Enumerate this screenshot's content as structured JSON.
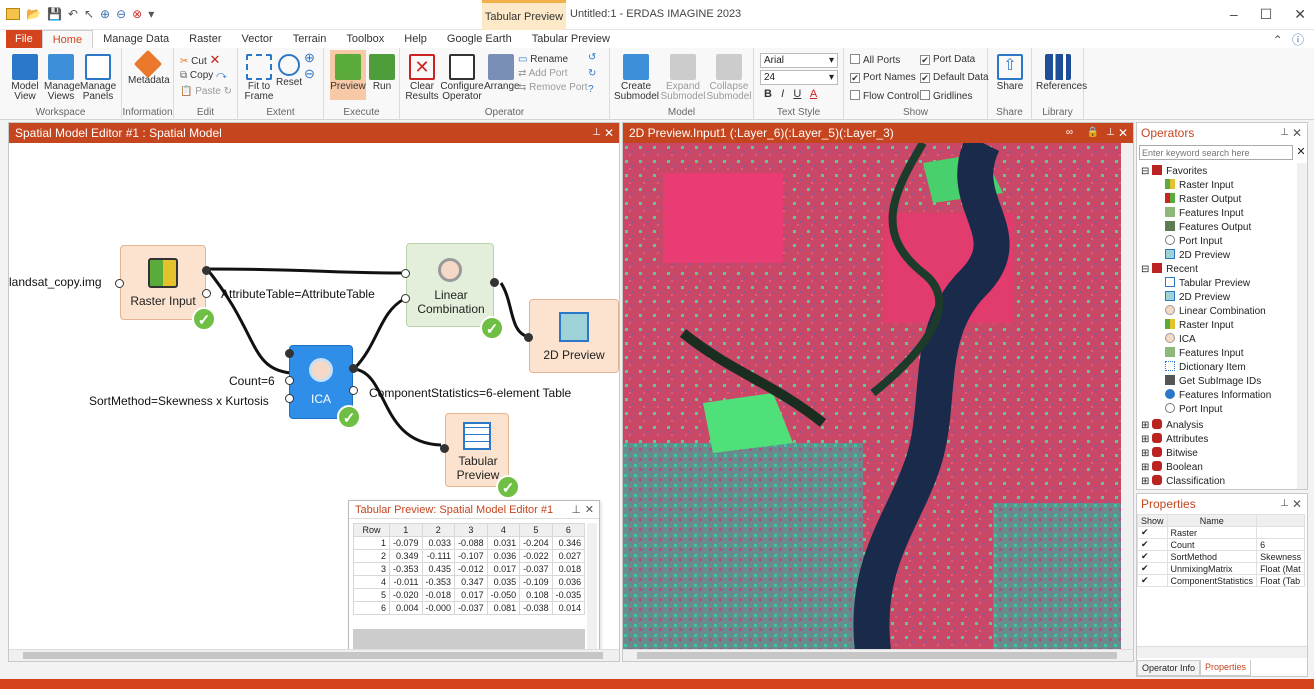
{
  "app": {
    "title": "Untitled:1 - ERDAS IMAGINE 2023",
    "contextual_tab": "Tabular Preview"
  },
  "tabs": [
    "File",
    "Home",
    "Manage Data",
    "Raster",
    "Vector",
    "Terrain",
    "Toolbox",
    "Help",
    "Google Earth",
    "Tabular Preview"
  ],
  "ribbon": {
    "workspace": {
      "label": "Workspace",
      "model_view": "Model View",
      "manage_views": "Manage Views",
      "manage_panels": "Manage Panels"
    },
    "information": {
      "label": "Information",
      "metadata": "Metadata"
    },
    "edit": {
      "label": "Edit",
      "cut": "Cut",
      "copy": "Copy",
      "paste": "Paste"
    },
    "extent": {
      "label": "Extent",
      "fit": "Fit to Frame",
      "reset": "Reset"
    },
    "execute": {
      "label": "Execute",
      "preview": "Preview",
      "run": "Run"
    },
    "operator": {
      "label": "Operator",
      "clear": "Clear Results",
      "configure": "Configure Operator",
      "arrange": "Arrange",
      "rename": "Rename",
      "add_port": "Add Port",
      "remove_port": "Remove Port"
    },
    "model": {
      "label": "Model",
      "create": "Create Submodel",
      "expand": "Expand Submodel",
      "collapse": "Collapse Submodel"
    },
    "text_style": {
      "label": "Text Style",
      "font": "Arial",
      "size": "24",
      "bold": "B",
      "italic": "I",
      "underline": "U",
      "color": "A"
    },
    "show": {
      "label": "Show",
      "all_ports": "All Ports",
      "port_data": "Port Data",
      "port_names": "Port Names",
      "default_data": "Default Data",
      "flow_control": "Flow Control",
      "gridlines": "Gridlines"
    },
    "share": {
      "label": "Share",
      "share": "Share"
    },
    "library": {
      "label": "Library",
      "references": "References"
    }
  },
  "editor": {
    "title": "Spatial Model Editor #1 : Spatial Model",
    "nodes": {
      "raster_input": "Raster Input",
      "linear_combination": "Linear Combination",
      "preview_2d": "2D Preview",
      "ica": "ICA",
      "tabular_preview": "Tabular Preview"
    },
    "labels": {
      "landsat": "landsat_copy.img",
      "attr": "AttributeTable=AttributeTable",
      "count": "Count=6",
      "sort": "SortMethod=Skewness x Kurtosis",
      "compstats": "ComponentStatistics=6-element Table"
    }
  },
  "tabular": {
    "title": "Tabular Preview: Spatial Model Editor #1",
    "columns": [
      "Row",
      "1",
      "2",
      "3",
      "4",
      "5",
      "6"
    ],
    "rows": [
      [
        "1",
        "-0.079",
        "0.033",
        "-0.088",
        "0.031",
        "-0.204",
        "0.346"
      ],
      [
        "2",
        "0.349",
        "-0.111",
        "-0.107",
        "0.036",
        "-0.022",
        "0.027"
      ],
      [
        "3",
        "-0.353",
        "0.435",
        "-0.012",
        "0.017",
        "-0.037",
        "0.018"
      ],
      [
        "4",
        "-0.011",
        "-0.353",
        "0.347",
        "0.035",
        "-0.109",
        "0.036"
      ],
      [
        "5",
        "-0.020",
        "-0.018",
        "0.017",
        "-0.050",
        "0.108",
        "-0.035"
      ],
      [
        "6",
        "0.004",
        "-0.000",
        "-0.037",
        "0.081",
        "-0.038",
        "0.014"
      ]
    ]
  },
  "preview": {
    "title": "2D Preview.Input1 (:Layer_6)(:Layer_5)(:Layer_3)"
  },
  "operators": {
    "title": "Operators",
    "search_placeholder": "Enter keyword search here",
    "favorites": "Favorites",
    "favorite_items": [
      "Raster Input",
      "Raster Output",
      "Features Input",
      "Features Output",
      "Port Input",
      "2D Preview"
    ],
    "recent": "Recent",
    "recent_items": [
      "Tabular Preview",
      "2D Preview",
      "Linear Combination",
      "Raster Input",
      "ICA",
      "Features Input",
      "Dictionary Item",
      "Get SubImage IDs",
      "Features Information",
      "Port Input"
    ],
    "categories": [
      "Analysis",
      "Attributes",
      "Bitwise",
      "Boolean",
      "Classification"
    ]
  },
  "properties": {
    "title": "Properties",
    "columns": [
      "Show",
      "Name",
      ""
    ],
    "rows": [
      [
        "✔",
        "Raster",
        ""
      ],
      [
        "✔",
        "Count",
        "6"
      ],
      [
        "✔",
        "SortMethod",
        "Skewness"
      ],
      [
        "✔",
        "UnmixingMatrix",
        "Float (Mat"
      ],
      [
        "✔",
        "ComponentStatistics",
        "Float (Tab"
      ]
    ],
    "tabs": [
      "Operator Info",
      "Properties"
    ]
  },
  "colors": {
    "accent": "#d3431d",
    "ica": "#2f8fe8",
    "linear": "#e3efdb",
    "raster": "#fbe3cf"
  }
}
